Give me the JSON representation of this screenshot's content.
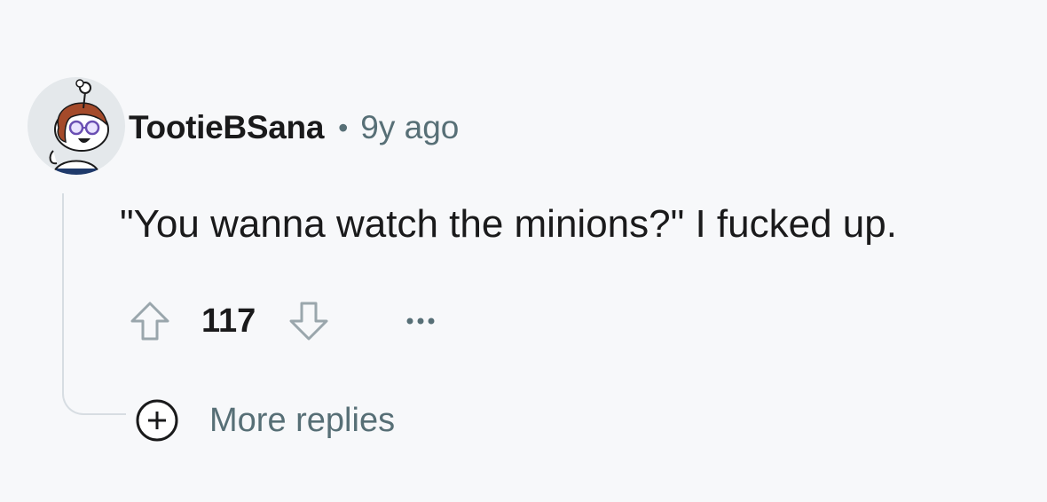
{
  "comment": {
    "author": "TootieBSana",
    "separator": "•",
    "timestamp": "9y ago",
    "body": "\"You wanna watch the minions?\" I fucked up.",
    "score": "117",
    "more_replies_label": "More replies"
  },
  "icons": {
    "avatar": "snoo-avatar",
    "upvote": "upvote-arrow-icon",
    "downvote": "downvote-arrow-icon",
    "overflow": "ellipsis-icon",
    "expand": "plus-circle-icon"
  },
  "colors": {
    "background": "#f7f8fa",
    "text_primary": "#1a1a1b",
    "text_secondary": "#576f76",
    "thread_line": "#d7dde2"
  }
}
